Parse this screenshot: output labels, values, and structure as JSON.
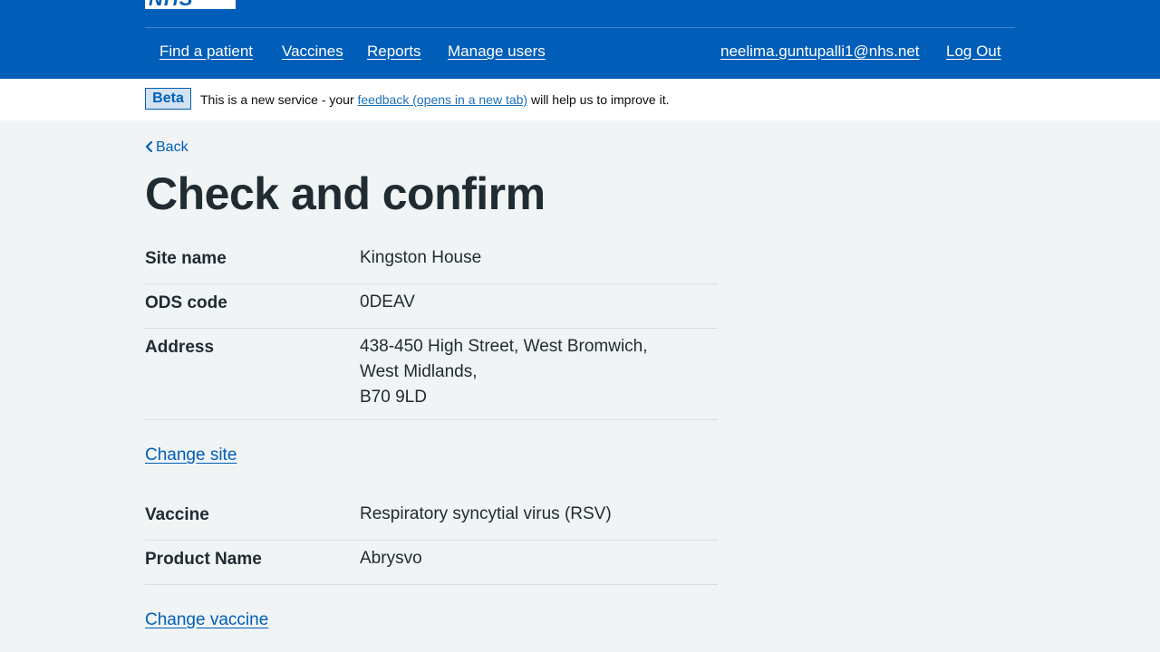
{
  "header": {
    "logo_text": "NHS",
    "nav": [
      {
        "label": "Find a patient"
      },
      {
        "label": "Vaccines"
      },
      {
        "label": "Reports"
      },
      {
        "label": "Manage users"
      }
    ],
    "user_email": "neelima.guntupalli1@nhs.net",
    "logout_label": "Log Out"
  },
  "phase_banner": {
    "tag": "Beta",
    "text_before": "This is a new service - your ",
    "link_text": "feedback (opens in a new tab)",
    "text_after": " will help us to improve it."
  },
  "back_label": "Back",
  "page_title": "Check and confirm",
  "site": {
    "rows": [
      {
        "key": "Site name",
        "value": "Kingston House"
      },
      {
        "key": "ODS code",
        "value": "0DEAV"
      },
      {
        "key": "Address",
        "lines": [
          "438-450 High Street, West Bromwich,",
          "West Midlands,",
          "B70 9LD"
        ]
      }
    ],
    "change_label": "Change site"
  },
  "vaccine": {
    "rows": [
      {
        "key": "Vaccine",
        "value": "Respiratory syncytial virus (RSV)"
      },
      {
        "key": "Product Name",
        "value": "Abrysvo"
      }
    ],
    "change_label": "Change vaccine"
  },
  "colors": {
    "brand_blue": "#005eb8",
    "page_bg": "#f0f4f5",
    "text": "#212b32"
  }
}
